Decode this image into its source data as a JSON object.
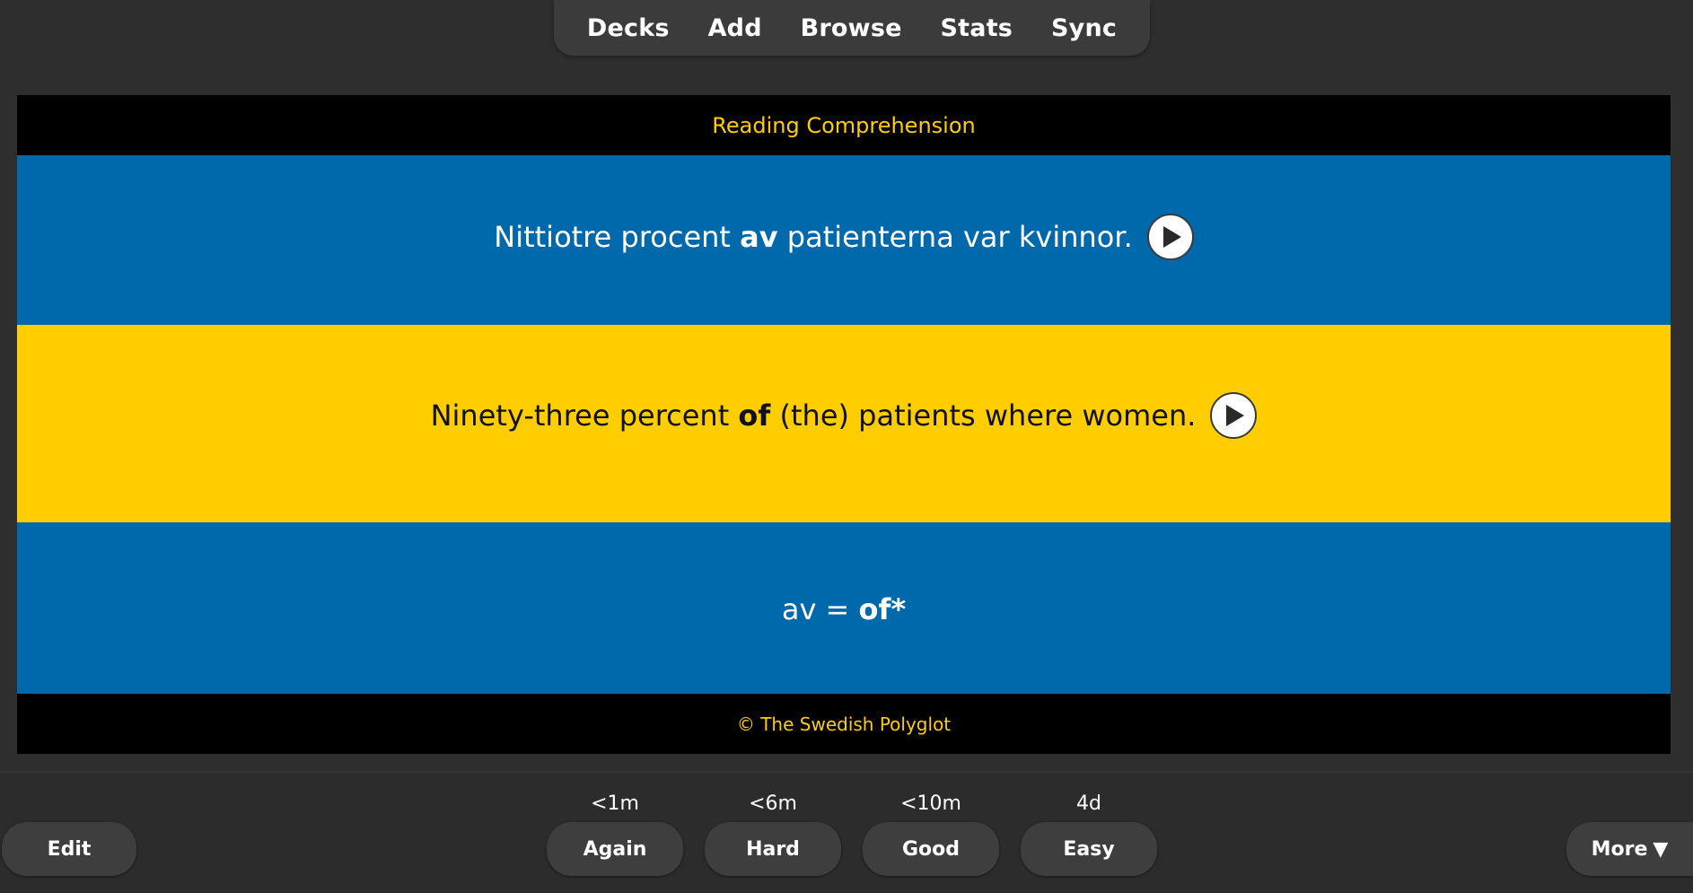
{
  "nav": {
    "items": [
      "Decks",
      "Add",
      "Browse",
      "Stats",
      "Sync"
    ]
  },
  "card": {
    "deck_title": "Reading Comprehension",
    "swedish": {
      "before": "Nittiotre procent ",
      "bold": "av",
      "after": " patienterna var kvinnor."
    },
    "english": {
      "before": "Ninety-three percent ",
      "bold": "of",
      "after": " (the) patients where women."
    },
    "note": {
      "before": "av = ",
      "bold": "of*"
    },
    "footer": "© The Swedish Polyglot",
    "play_icon": "play-icon"
  },
  "answer_bar": {
    "edit_label": "Edit",
    "more_label": "More",
    "more_icon": "triangle-down-icon",
    "buttons": [
      {
        "label": "Again",
        "interval": "<1m"
      },
      {
        "label": "Hard",
        "interval": "<6m"
      },
      {
        "label": "Good",
        "interval": "<10m"
      },
      {
        "label": "Easy",
        "interval": "4d"
      }
    ]
  },
  "colors": {
    "swedish_blue": "#0069ab",
    "swedish_yellow": "#ffcd00",
    "background": "#2e2e2e"
  }
}
